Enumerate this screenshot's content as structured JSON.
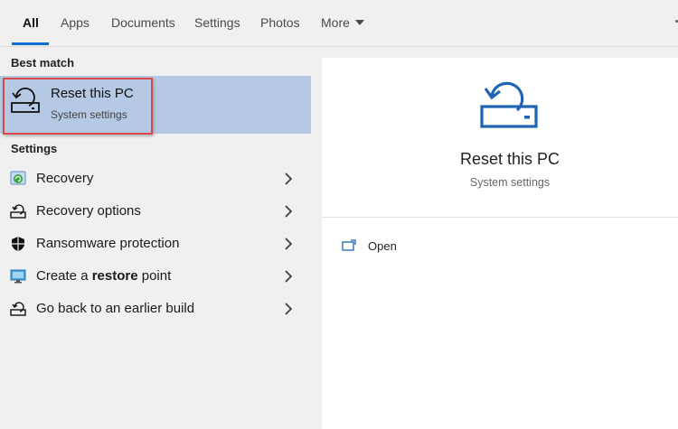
{
  "tabs": [
    {
      "label": "All",
      "active": true
    },
    {
      "label": "Apps"
    },
    {
      "label": "Documents"
    },
    {
      "label": "Settings"
    },
    {
      "label": "Photos"
    },
    {
      "label": "More"
    }
  ],
  "best_match": {
    "section_label": "Best match",
    "title": "Reset this PC",
    "subtitle": "System settings",
    "icon": "reset-pc-icon"
  },
  "settings_section": {
    "label": "Settings",
    "items": [
      {
        "label": "Recovery",
        "icon": "recovery-icon"
      },
      {
        "label": "Recovery options",
        "icon": "reset-pc-icon"
      },
      {
        "label": "Ransomware protection",
        "icon": "shield-icon"
      },
      {
        "label_pre": "Create a ",
        "label_bold": "restore",
        "label_post": " point",
        "icon": "monitor-icon"
      },
      {
        "label": "Go back to an earlier build",
        "icon": "reset-pc-icon"
      }
    ]
  },
  "preview": {
    "title": "Reset this PC",
    "subtitle": "System settings",
    "actions": [
      {
        "label": "Open",
        "icon": "open-window-icon"
      }
    ]
  },
  "colors": {
    "accent": "#0b6fd0",
    "icon_blue": "#1e63b4",
    "best_match_bg": "#b5c8e4",
    "highlight_border": "#d9484a"
  }
}
